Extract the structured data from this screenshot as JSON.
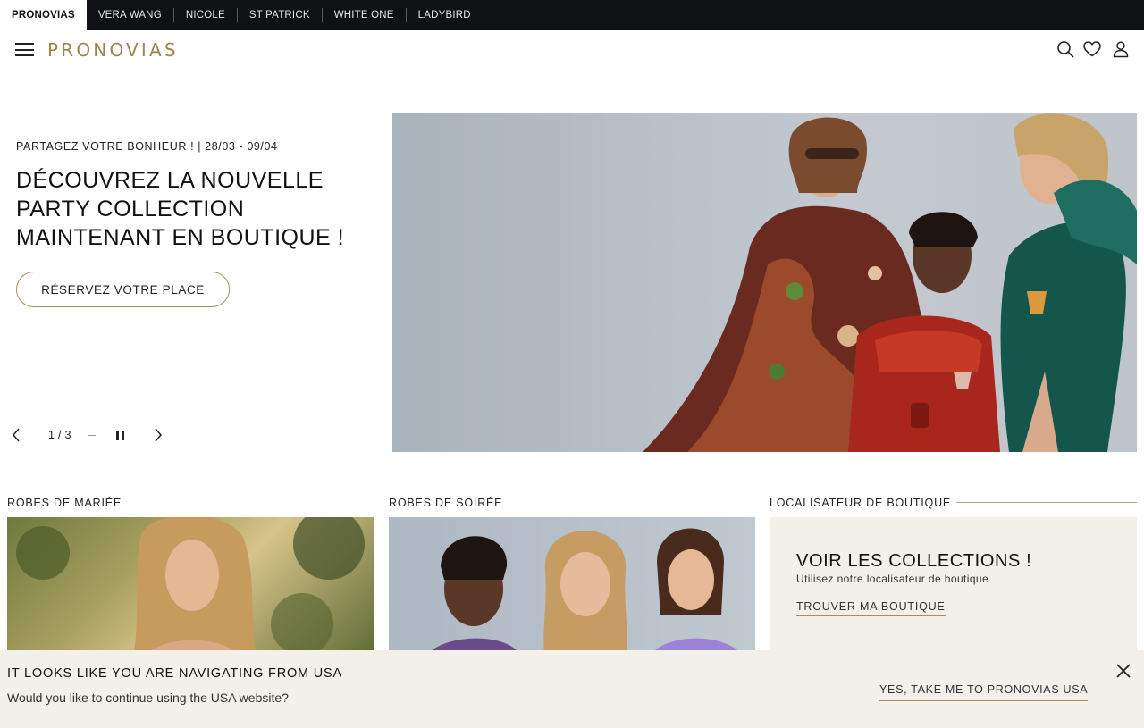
{
  "brand_bar": {
    "brands": [
      {
        "label": "PRONOVIAS",
        "active": true
      },
      {
        "label": "VERA WANG",
        "active": false
      },
      {
        "label": "NICOLE",
        "active": false
      },
      {
        "label": "ST PATRICK",
        "active": false
      },
      {
        "label": "WHITE ONE",
        "active": false
      },
      {
        "label": "LADYBIRD",
        "active": false
      }
    ]
  },
  "header": {
    "logo": "PRONOVIAS",
    "menu_icon": "hamburger-menu-icon",
    "icons": [
      "search-icon",
      "heart-icon",
      "user-icon"
    ],
    "brand_color": "#9b8450"
  },
  "hero": {
    "kicker": "PARTAGEZ VOTRE BONHEUR ! | 28/03 - 09/04",
    "title_lines": [
      "DÉCOUVREZ LA NOUVELLE",
      "PARTY COLLECTION",
      "MAINTENANT EN BOUTIQUE !"
    ],
    "cta": "RÉSERVEZ VOTRE PLACE",
    "slide_current": "1",
    "slide_sep": "/",
    "slide_total": "3",
    "image_icon": "hero-photo-three-women-party-dresses"
  },
  "categories": [
    {
      "label": "ROBES DE MARIÉE"
    },
    {
      "label": "ROBES DE SOIRÉE"
    },
    {
      "label": "LOCALISATEUR DE BOUTIQUE"
    }
  ],
  "locator": {
    "title": "VOIR LES COLLECTIONS !",
    "subtitle": "Utilisez notre localisateur de boutique",
    "link": "TROUVER MA BOUTIQUE",
    "bg_color": "#f3efe9"
  },
  "geo_banner": {
    "title": "IT LOOKS LIKE YOU ARE NAVIGATING FROM USA",
    "subtitle": "Would you like to continue using the USA website?",
    "link": "YES, TAKE ME TO PRONOVIAS USA",
    "close_icon": "close-icon"
  },
  "accent_color": "#a58f5e"
}
